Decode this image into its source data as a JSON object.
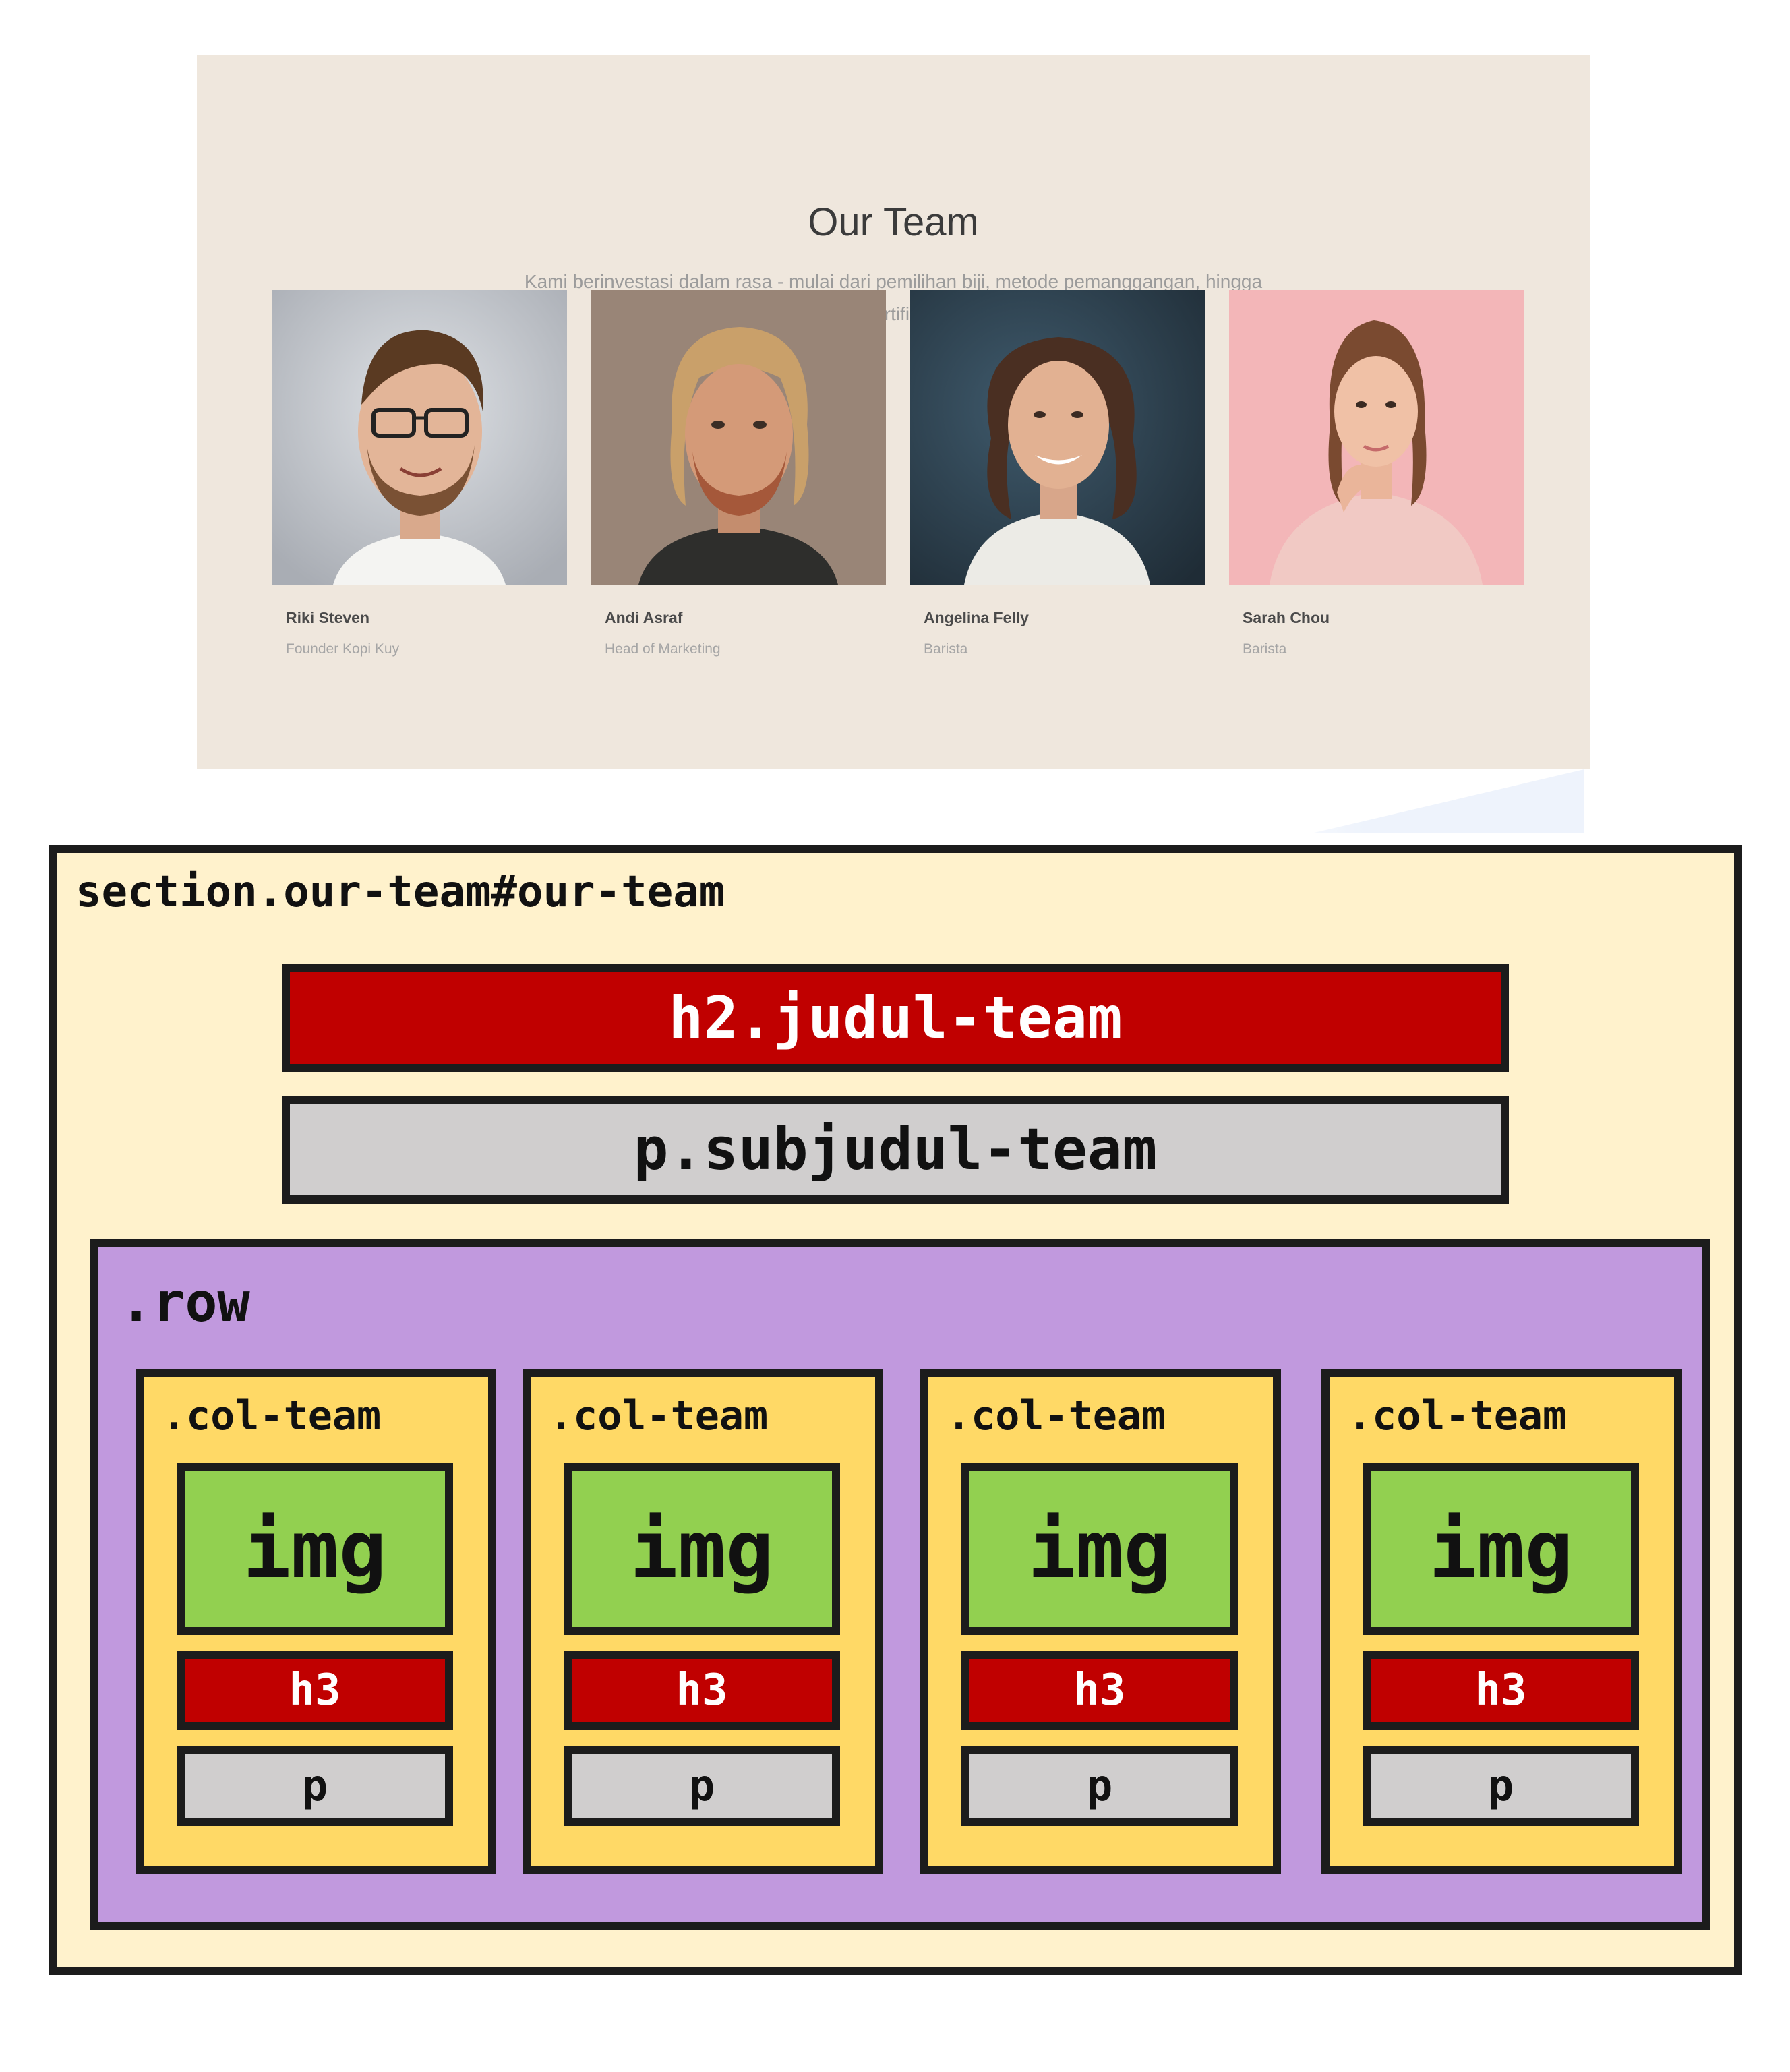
{
  "website": {
    "title": "Our Team",
    "subtitle_line1": "Kami berinvestasi dalam rasa - mulai dari pemilihan biji, metode pemanggangan, hingga",
    "subtitle_line2": "barista dengan sertifikat internasional.",
    "members": [
      {
        "name": "Riki Steven",
        "role": "Founder Kopi Kuy"
      },
      {
        "name": "Andi Asraf",
        "role": "Head of Marketing"
      },
      {
        "name": "Angelina Felly",
        "role": "Barista"
      },
      {
        "name": "Sarah Chou",
        "role": "Barista"
      }
    ]
  },
  "diagram": {
    "section_label": "section.our-team#our-team",
    "heading_label": "h2.judul-team",
    "subheading_label": "p.subjudul-team",
    "row_label": ".row",
    "columns": [
      {
        "label": ".col-team",
        "img": "img",
        "h3": "h3",
        "p": "p"
      },
      {
        "label": ".col-team",
        "img": "img",
        "h3": "h3",
        "p": "p"
      },
      {
        "label": ".col-team",
        "img": "img",
        "h3": "h3",
        "p": "p"
      },
      {
        "label": ".col-team",
        "img": "img",
        "h3": "h3",
        "p": "p"
      }
    ],
    "colors": {
      "section": "#fff2cc",
      "h2": "#c00000",
      "p": "#d0cece",
      "row": "#c199de",
      "col": "#ffd966",
      "img": "#92d050",
      "border": "#1c1c1c"
    }
  }
}
